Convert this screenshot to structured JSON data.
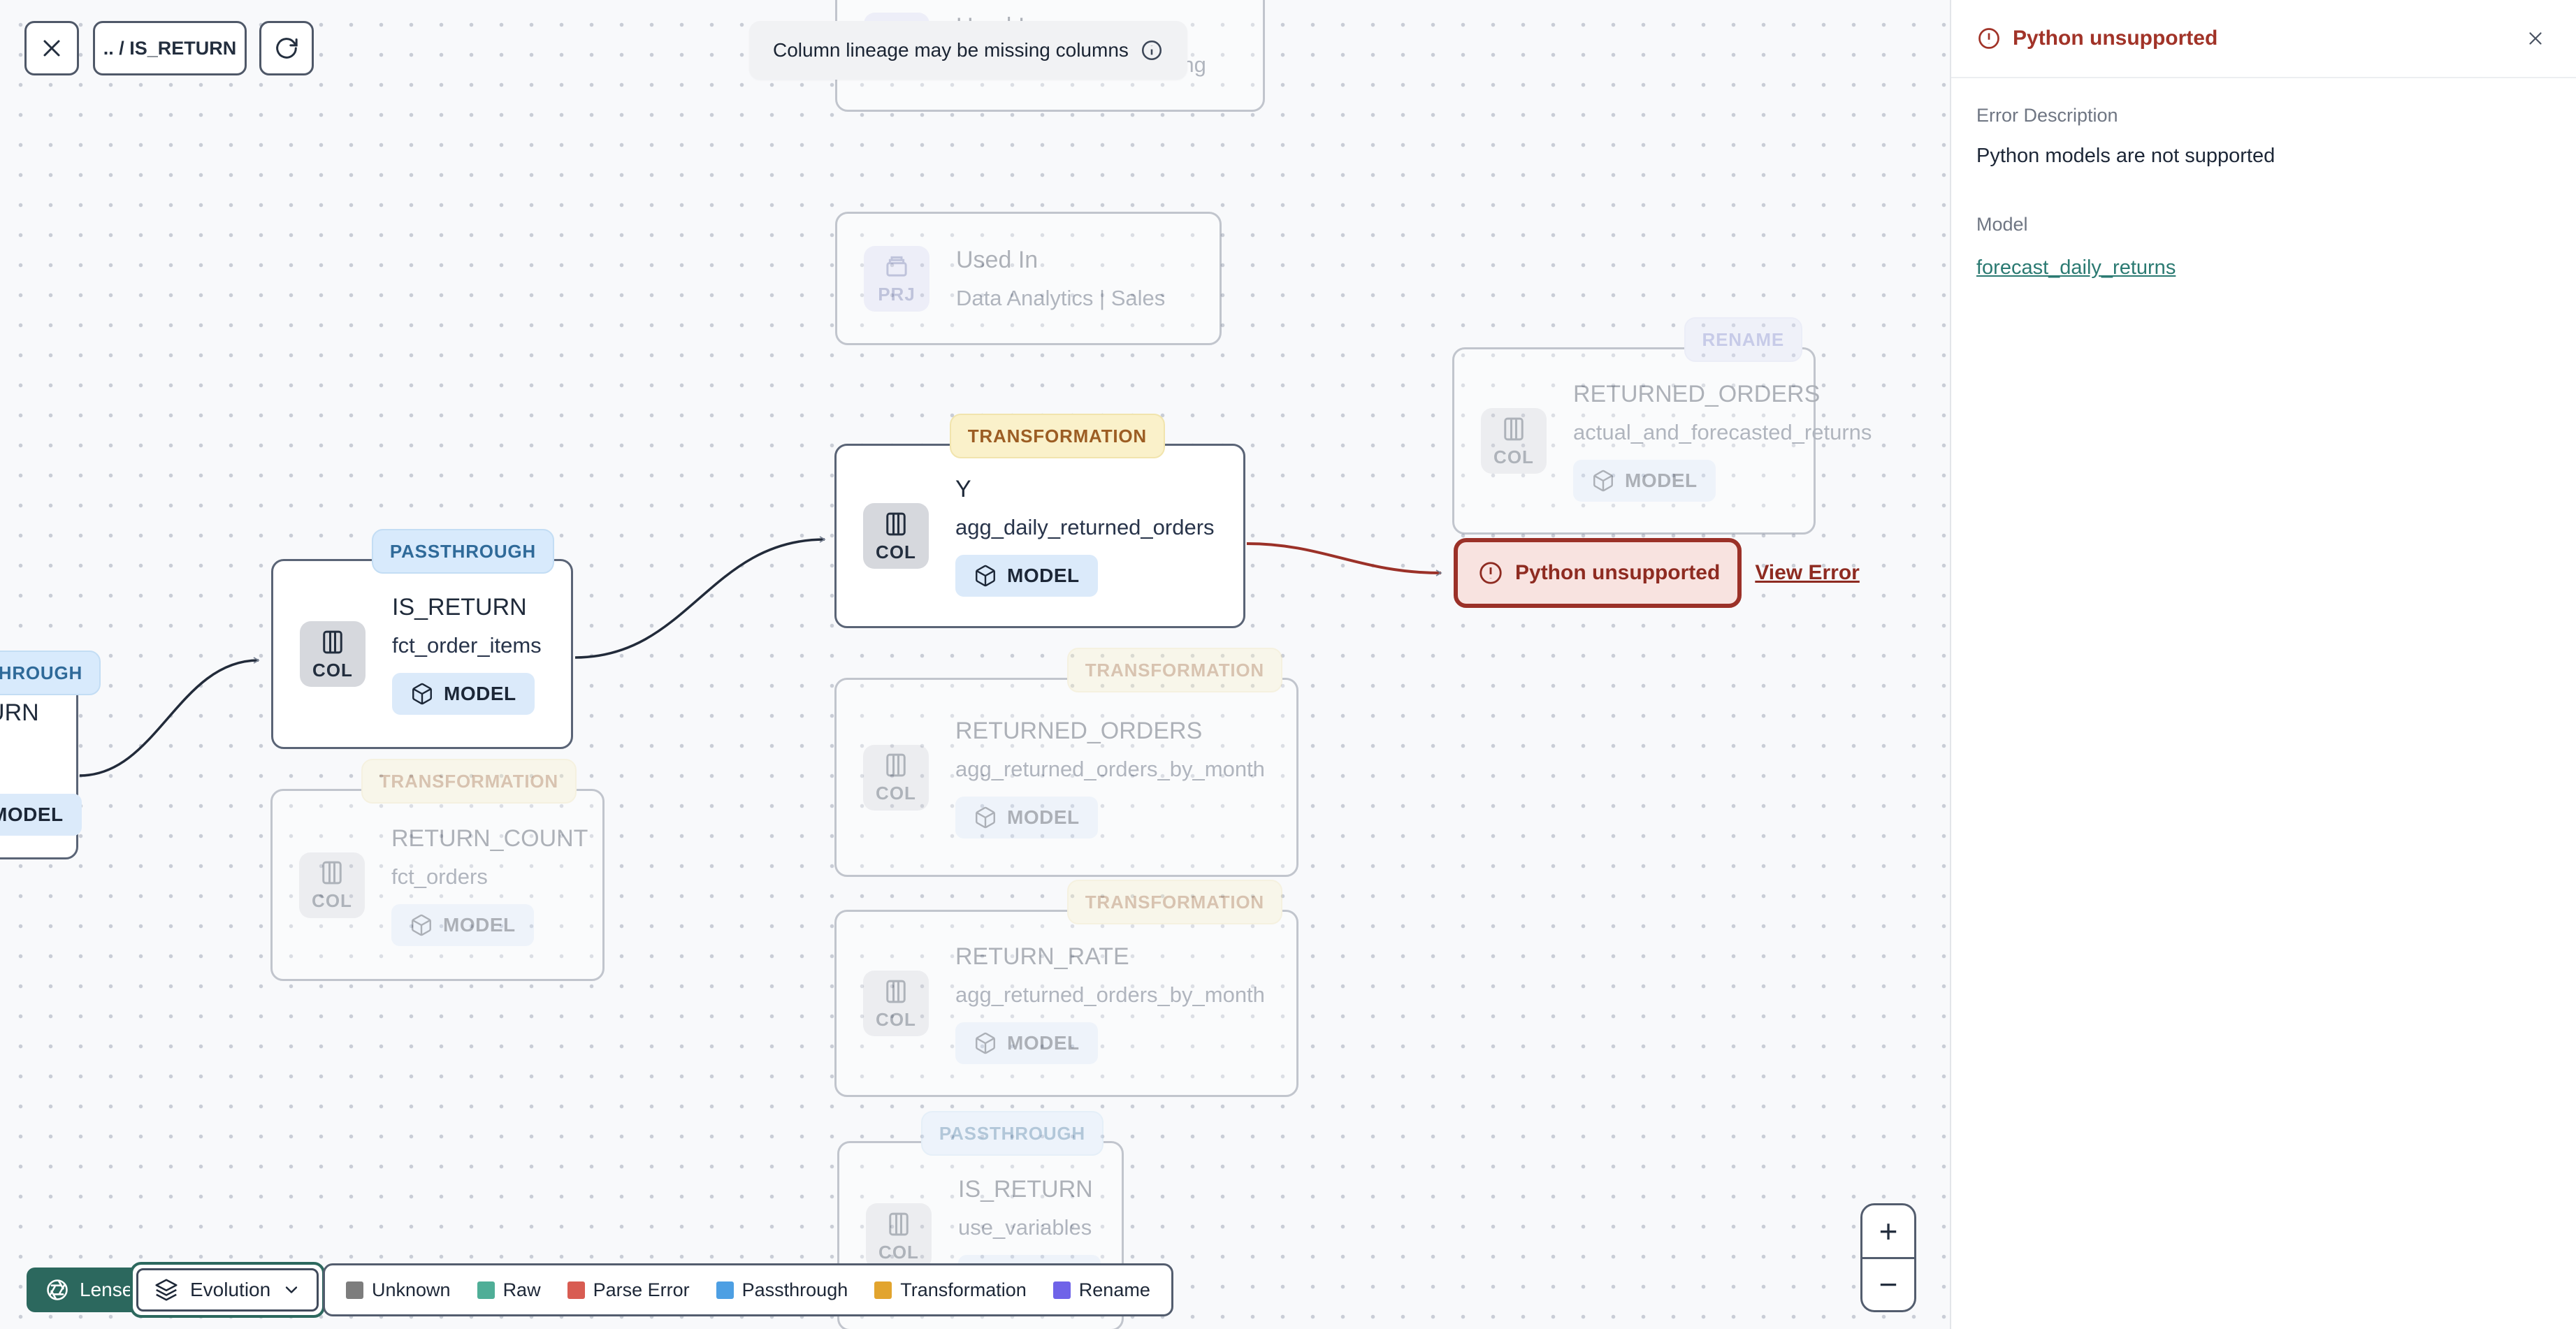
{
  "toolbar": {
    "breadcrumb": ".. / IS_RETURN"
  },
  "banner": {
    "text": "Column lineage may be missing columns"
  },
  "canvas": {
    "nodes": [
      {
        "id": "used-in-marketing",
        "title": "Used In",
        "subtitle": "Data Analytics | Marketing",
        "icon": "PRJ",
        "state": "faded"
      },
      {
        "id": "used-in-sales",
        "title": "Used In",
        "subtitle": "Data Analytics | Sales",
        "icon": "PRJ",
        "state": "faded"
      },
      {
        "id": "is-return-upstream",
        "badge": "PASSTHROUGH",
        "title": "IS_RETURN",
        "subtitle": "fct_order_items",
        "icon": "COL",
        "chip": "MODEL",
        "state": "active"
      },
      {
        "id": "is-return-fct-order-items",
        "badge": "PASSTHROUGH",
        "title": "IS_RETURN",
        "subtitle": "fct_order_items",
        "icon": "COL",
        "chip": "MODEL",
        "state": "active"
      },
      {
        "id": "y-agg-daily-returned-orders",
        "badge": "TRANSFORMATION",
        "title": "Y",
        "subtitle": "agg_daily_returned_orders",
        "icon": "COL",
        "chip": "MODEL",
        "state": "active"
      },
      {
        "id": "returned-orders-forecast",
        "badge": "RENAME",
        "title": "RETURNED_ORDERS",
        "subtitle": "actual_and_forecasted_returns",
        "icon": "COL",
        "chip": "MODEL",
        "state": "faded"
      },
      {
        "id": "returned-orders-by-month",
        "badge": "TRANSFORMATION",
        "title": "RETURNED_ORDERS",
        "subtitle": "agg_returned_orders_by_month",
        "icon": "COL",
        "chip": "MODEL",
        "state": "faded"
      },
      {
        "id": "return-rate",
        "badge": "TRANSFORMATION",
        "title": "RETURN_RATE",
        "subtitle": "agg_returned_orders_by_month",
        "icon": "COL",
        "chip": "MODEL",
        "state": "faded"
      },
      {
        "id": "return-count",
        "badge": "TRANSFORMATION",
        "title": "RETURN_COUNT",
        "subtitle": "fct_orders",
        "icon": "COL",
        "chip": "MODEL",
        "state": "faded"
      },
      {
        "id": "is-return-use-variables",
        "badge": "PASSTHROUGH",
        "title": "IS_RETURN",
        "subtitle": "use_variables",
        "icon": "COL",
        "chip": "MODEL",
        "state": "faded"
      }
    ],
    "error_chip": {
      "text": "Python unsupported",
      "link": "View Error"
    }
  },
  "legend": {
    "items": [
      {
        "label": "Unknown",
        "color": "#7d7d7d"
      },
      {
        "label": "Raw",
        "color": "#4fae97"
      },
      {
        "label": "Parse Error",
        "color": "#d85c52"
      },
      {
        "label": "Passthrough",
        "color": "#4d9fe3"
      },
      {
        "label": "Transformation",
        "color": "#e2a42e"
      },
      {
        "label": "Rename",
        "color": "#6f63e8"
      }
    ]
  },
  "lenses_button": {
    "label": "Lenses"
  },
  "evolution_dropdown": {
    "label": "Evolution"
  },
  "zoom_controls": {
    "zoom_in": "+",
    "zoom_out": "−"
  },
  "panel": {
    "title": "Python unsupported",
    "error_description_label": "Error Description",
    "error_description": "Python models are not supported",
    "model_label": "Model",
    "model_link": "forecast_daily_returns"
  },
  "colors": {
    "accent_teal": "#2c685e",
    "error_red": "#9b3128",
    "link_teal": "#2b7a72",
    "badge_passthrough_bg": "#d8eafc",
    "badge_passthrough_text": "#2f6a99",
    "badge_transformation_bg": "#faf1ca",
    "badge_transformation_text": "#9c5d23",
    "badge_rename_bg": "#dfe3f8",
    "model_chip_bg": "#dbeafa",
    "canvas_bg": "#f8f9fb"
  }
}
